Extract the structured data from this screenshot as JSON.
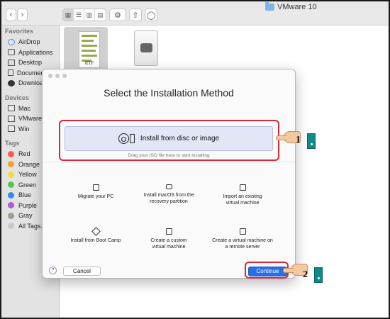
{
  "window": {
    "title": "VMware 10"
  },
  "toolbar": {
    "back": "‹",
    "forward": "›",
    "views": [
      "▦",
      "☰",
      "▥",
      "▤"
    ],
    "settings": "⚙",
    "share": "⇧",
    "tag": "◯"
  },
  "sidebar": {
    "favorites_header": "Favorites",
    "favorites": [
      {
        "label": "AirDrop",
        "icon": "airdrop-icon"
      },
      {
        "label": "Applications",
        "icon": "applications-icon"
      },
      {
        "label": "Desktop",
        "icon": "desktop-icon"
      },
      {
        "label": "Documents",
        "icon": "documents-icon"
      },
      {
        "label": "Downloads",
        "icon": "downloads-icon"
      }
    ],
    "devices_header": "Devices",
    "devices": [
      {
        "label": "Mac",
        "icon": "disk-icon"
      },
      {
        "label": "VMware F",
        "icon": "disk-icon"
      },
      {
        "label": "Win",
        "icon": "disk-icon"
      }
    ],
    "tags_header": "Tags",
    "tags": [
      {
        "label": "Red",
        "color": "#ff5b51"
      },
      {
        "label": "Orange",
        "color": "#ff9d2d"
      },
      {
        "label": "Yellow",
        "color": "#ffd93a"
      },
      {
        "label": "Green",
        "color": "#4ec74f"
      },
      {
        "label": "Blue",
        "color": "#2f8cf5"
      },
      {
        "label": "Purple",
        "color": "#b05bd6"
      },
      {
        "label": "Gray",
        "color": "#9a9a9a"
      },
      {
        "label": "All Tags...",
        "color": "#c9c9c9"
      }
    ]
  },
  "files": {
    "doc_tag": "RTF"
  },
  "dialog": {
    "title": "Select the Installation Method",
    "primary_option": "Install from disc or image",
    "drag_hint": "Drag your ISO file here to start installing",
    "options": [
      {
        "line1": "Migrate your PC",
        "line2": "",
        "icon": "migrate-pc-icon"
      },
      {
        "line1": "Install macOS from the",
        "line2": "recovery partition",
        "icon": "recovery-drive-icon"
      },
      {
        "line1": "Import an existing",
        "line2": "virtual machine",
        "icon": "import-vm-icon"
      },
      {
        "line1": "Install from Boot Camp",
        "line2": "",
        "icon": "boot-camp-icon"
      },
      {
        "line1": "Create a custom",
        "line2": "virtual machine",
        "icon": "custom-vm-icon"
      },
      {
        "line1": "Create a virtual machine on",
        "line2": "a remote server",
        "icon": "remote-server-icon"
      }
    ],
    "help": "?",
    "cancel": "Cancel",
    "continue": "Continue"
  },
  "annotations": {
    "step1": "1",
    "step2": "2"
  },
  "colors": {
    "accent": "#2a6ee6",
    "highlight": "#d7263d",
    "cuff": "#0f8a88"
  }
}
